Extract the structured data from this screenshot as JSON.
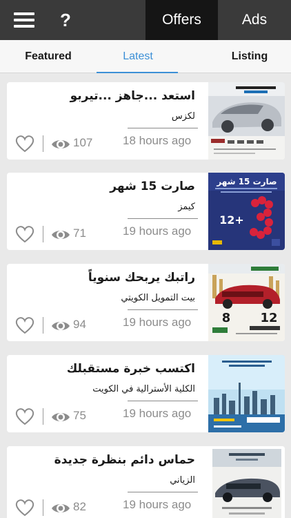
{
  "topbar": {
    "tabs": {
      "offers": "Offers",
      "ads": "Ads"
    },
    "active_tab": "Offers"
  },
  "subtabs": {
    "featured": "Featured",
    "latest": "Latest",
    "listing": "Listing",
    "active": "Latest"
  },
  "colors": {
    "topbar": "#3a3a3a",
    "active_top_tab": "#151515",
    "accent": "#3b8fd6",
    "background": "#e9e9e9",
    "muted_text": "#8c8c8c"
  },
  "items": [
    {
      "title": "استعد ...جاهز ...تيربو",
      "advertiser": "لكزس",
      "views": "107",
      "time": "18 hours ago"
    },
    {
      "title": "صارت 15 شهر",
      "advertiser": "كيمز",
      "views": "71",
      "time": "19 hours ago",
      "thumb_text": {
        "headline": "صارت 15 شهر",
        "badge": "12+"
      }
    },
    {
      "title": "راتبك يربحك سنوياً",
      "advertiser": "بيت التمويل الكويتي",
      "views": "94",
      "time": "19 hours ago"
    },
    {
      "title": "اكتسب خبرة مستقبلك",
      "advertiser": "الكلية الأسترالية في الكويت",
      "views": "75",
      "time": "19 hours ago"
    },
    {
      "title": "حماس دائم بنظرة جديدة",
      "advertiser": "الزياني",
      "views": "82",
      "time": "19 hours ago"
    }
  ]
}
